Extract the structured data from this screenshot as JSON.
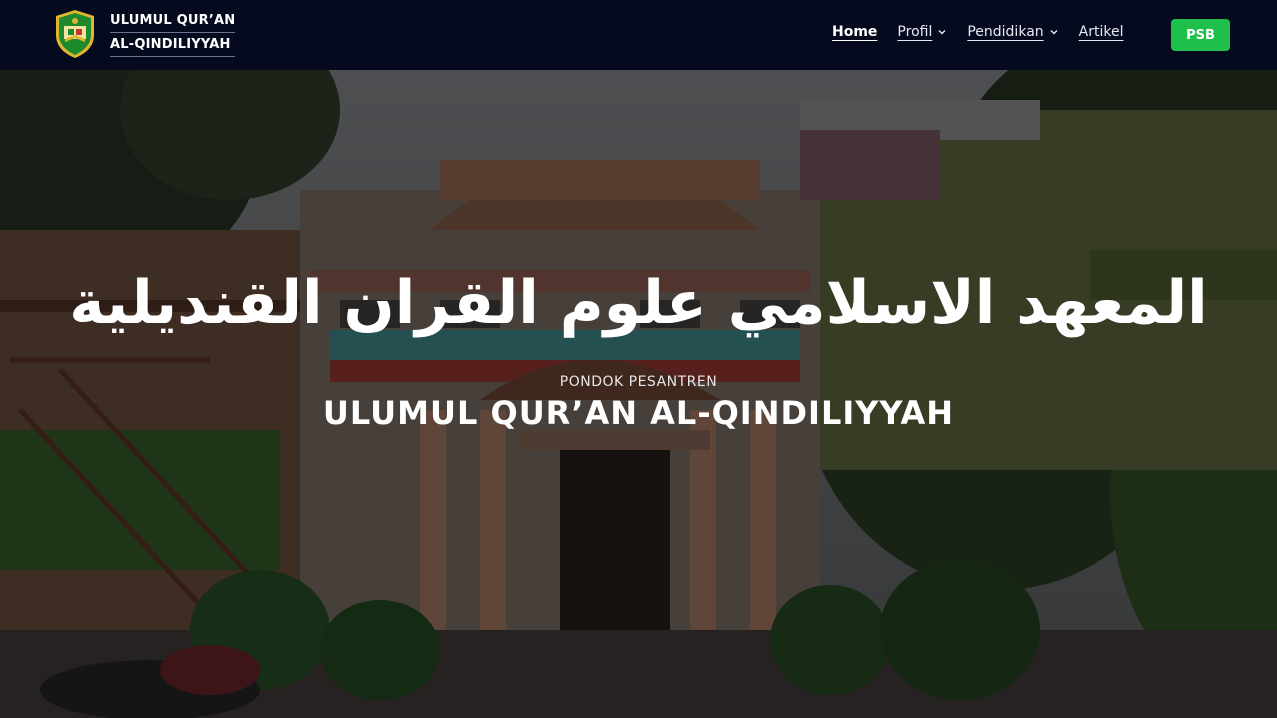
{
  "navbar": {
    "brand_line1": "ULUMUL QUR’AN",
    "brand_line2": "AL-QINDILIYYAH",
    "logo_icon": "school-shield-logo",
    "menu": [
      {
        "label": "Home",
        "active": true,
        "dropdown": false
      },
      {
        "label": "Profil",
        "active": false,
        "dropdown": true
      },
      {
        "label": "Pendidikan",
        "active": false,
        "dropdown": true
      },
      {
        "label": "Artikel",
        "active": false,
        "dropdown": false
      }
    ],
    "cta_label": "PSB"
  },
  "hero": {
    "arabic_title": "المعهد الاسلامي علوم القران القنديلية",
    "subtitle": "PONDOK PESANTREN",
    "headline": "ULUMUL QUR’AN AL-QINDILIYYAH",
    "background": "school-building-photo"
  },
  "colors": {
    "navbar_bg": "#050a1e",
    "cta_bg": "#1fbf4c",
    "logo_green": "#1e8a2e",
    "logo_gold": "#e0b630"
  }
}
